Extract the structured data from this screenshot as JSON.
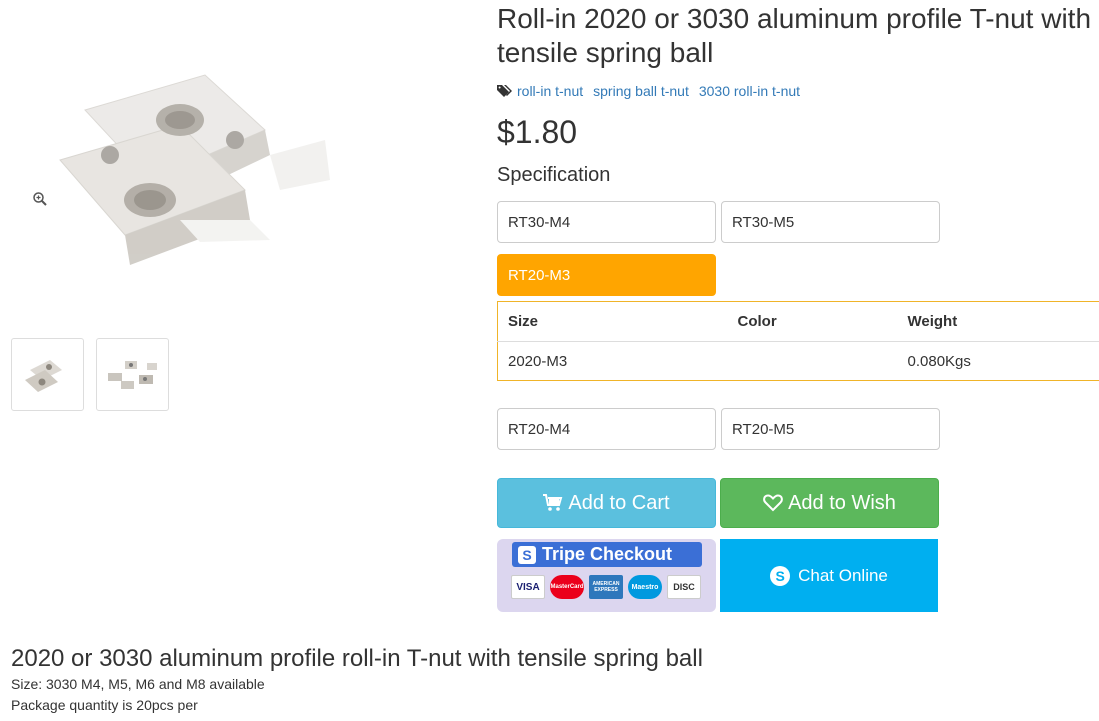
{
  "product": {
    "title": "Roll-in 2020 or 3030 aluminum profile T-nut with tensile spring ball",
    "tags": [
      "roll-in t-nut",
      "spring ball t-nut",
      "3030 roll-in t-nut"
    ],
    "price": "$1.80",
    "spec_label": "Specification"
  },
  "options": {
    "row1": [
      "RT30-M4",
      "RT30-M5"
    ],
    "selected": "RT20-M3",
    "row3": [
      "RT20-M4",
      "RT20-M5"
    ]
  },
  "spec_table": {
    "headers": [
      "Size",
      "Color",
      "Weight"
    ],
    "row": [
      "2020-M3",
      "",
      "0.080Kgs"
    ]
  },
  "actions": {
    "add_to_cart": "Add to Cart",
    "add_to_wish": "Add to Wish",
    "stripe_checkout": "Tripe Checkout",
    "stripe_badge": "S",
    "cards": [
      "VISA",
      "MasterCard",
      "AMERICAN EXPRESS",
      "Maestro",
      "DISC"
    ],
    "chat_online": "Chat Online"
  },
  "description": {
    "heading": "2020 or 3030 aluminum profile roll-in T-nut with tensile spring ball",
    "lines": [
      "Size: 3030 M4, M5, M6 and M8 available",
      "Package quantity is 20pcs per"
    ]
  },
  "icons": {
    "tag": "tags-icon",
    "cart": "cart-icon",
    "heart": "heart-icon",
    "zoom": "zoom-icon",
    "skype": "skype-icon"
  },
  "colors": {
    "selected_option": "#ffa500",
    "cart_button": "#5bc0de",
    "wish_button": "#5cb85c",
    "chat_button": "#00aff0",
    "link": "#337ab7",
    "table_border": "#f0b429"
  }
}
